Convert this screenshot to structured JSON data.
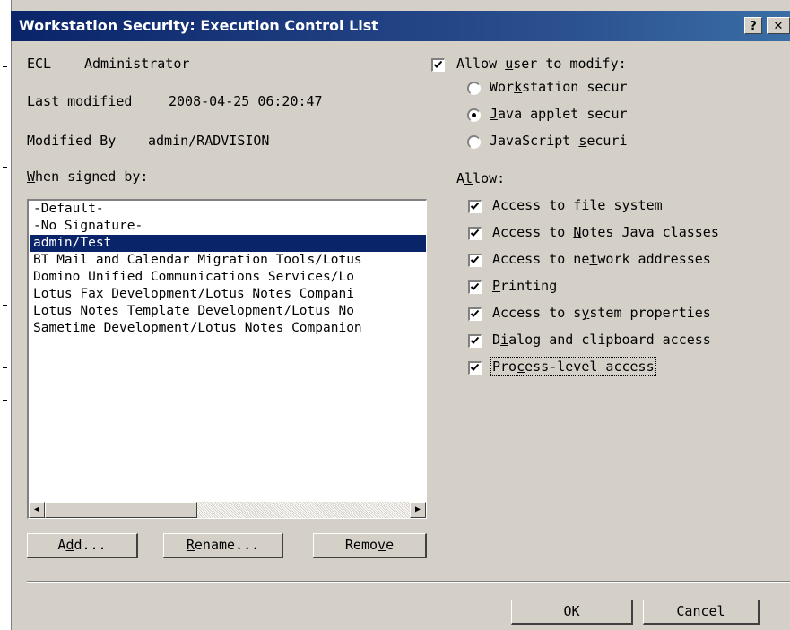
{
  "window": {
    "title": "Workstation Security: Execution Control List",
    "help_glyph": "?",
    "close_glyph": "✕"
  },
  "info": {
    "ecl_label": "ECL",
    "ecl_value": "Administrator",
    "last_modified_label": "Last modified",
    "last_modified_value": "2008-04-25 06:20:47",
    "modified_by_label": "Modified By",
    "modified_by_value": "admin/RADVISION"
  },
  "signers": {
    "label_mnemonic": "W",
    "label_rest": "hen signed by:",
    "items": [
      "-Default-",
      "-No Signature-",
      "admin/Test",
      "BT Mail and Calendar Migration Tools/Lotus",
      "Domino Unified Communications Services/Lo",
      "Lotus Fax Development/Lotus Notes Compani",
      "Lotus Notes Template Development/Lotus No",
      "Sametime Development/Lotus Notes Companion"
    ],
    "selected_index": 2
  },
  "buttons": {
    "add": {
      "pre": "A",
      "mn": "d",
      "post": "d..."
    },
    "rename": {
      "pre": "",
      "mn": "R",
      "post": "ename..."
    },
    "remove": {
      "pre": "Remo",
      "mn": "v",
      "post": "e"
    },
    "ok": "OK",
    "cancel": "Cancel"
  },
  "modify": {
    "checked": true,
    "pre": "Allow ",
    "mn": "u",
    "post": "ser to modify:",
    "options": [
      {
        "pre": "Wor",
        "mn": "k",
        "post": "station secur",
        "selected": false
      },
      {
        "pre": "",
        "mn": "J",
        "post": "ava applet secur",
        "selected": true
      },
      {
        "pre": "JavaScript ",
        "mn": "s",
        "post": "ecuri",
        "selected": false
      }
    ]
  },
  "allow": {
    "pre": "A",
    "mn": "l",
    "post": "low:",
    "items": [
      {
        "pre": "",
        "mn": "A",
        "post": "ccess to file system",
        "checked": true
      },
      {
        "pre": "Access to ",
        "mn": "N",
        "post": "otes Java classes",
        "checked": true
      },
      {
        "pre": "Access to ne",
        "mn": "t",
        "post": "work addresses",
        "checked": true
      },
      {
        "pre": "",
        "mn": "P",
        "post": "rinting",
        "checked": true
      },
      {
        "pre": "Access to s",
        "mn": "y",
        "post": "stem properties",
        "checked": true
      },
      {
        "pre": "D",
        "mn": "i",
        "post": "alog and clipboard access",
        "checked": true
      },
      {
        "pre": "Pro",
        "mn": "c",
        "post": "ess-level access",
        "checked": true
      }
    ]
  }
}
